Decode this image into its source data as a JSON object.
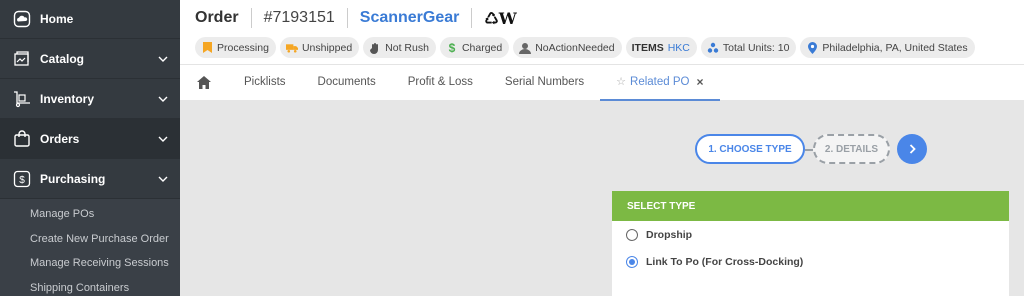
{
  "sidebar": {
    "items": [
      {
        "label": "Home",
        "icon": "cloud-icon",
        "has_chevron": false
      },
      {
        "label": "Catalog",
        "icon": "catalog-icon",
        "has_chevron": true
      },
      {
        "label": "Inventory",
        "icon": "inventory-icon",
        "has_chevron": true
      },
      {
        "label": "Orders",
        "icon": "shopping-bag-icon",
        "has_chevron": true,
        "active": true
      },
      {
        "label": "Purchasing",
        "icon": "dollar-icon",
        "has_chevron": true
      }
    ],
    "subitems": [
      "Manage POs",
      "Create New Purchase Order",
      "Manage Receiving Sessions",
      "Shipping Containers"
    ]
  },
  "header": {
    "order_label": "Order",
    "order_number": "#7193151",
    "store_name": "ScannerGear",
    "brand_logo": "♺W"
  },
  "badges": [
    {
      "label": "Processing",
      "icon": "bookmark-icon",
      "icon_color": "#f5a623"
    },
    {
      "label": "Unshipped",
      "icon": "truck-icon",
      "icon_color": "#f5a623"
    },
    {
      "label": "Not Rush",
      "icon": "hand-icon",
      "icon_color": "#555555"
    },
    {
      "label": "Charged",
      "icon": "dollar-icon",
      "icon_color": "#4caf50"
    },
    {
      "label": "NoActionNeeded",
      "icon": "user-icon",
      "icon_color": "#666666"
    },
    {
      "label_bold": "ITEMS",
      "label": "HKC",
      "icon": ""
    },
    {
      "label": "Total Units: 10",
      "icon": "cubes-icon",
      "icon_color": "#3a7bd5"
    },
    {
      "label": "Philadelphia, PA, United States",
      "icon": "map-pin-icon",
      "icon_color": "#3a7bd5"
    }
  ],
  "tabs": [
    {
      "label": "Picklists"
    },
    {
      "label": "Documents"
    },
    {
      "label": "Profit & Loss"
    },
    {
      "label": "Serial Numbers"
    },
    {
      "label": "Related PO",
      "active": true
    }
  ],
  "wizard": {
    "step1": "1. CHOOSE TYPE",
    "step2": "2. DETAILS"
  },
  "select_type": {
    "title": "SELECT TYPE",
    "options": [
      {
        "label": "Dropship",
        "checked": false
      },
      {
        "label": "Link To Po (For Cross-Docking)",
        "checked": true
      }
    ]
  },
  "colors": {
    "sidebar_bg": "#343a40",
    "accent": "#4a86e8",
    "card_header": "#7cb944",
    "link": "#3a7bd5"
  }
}
